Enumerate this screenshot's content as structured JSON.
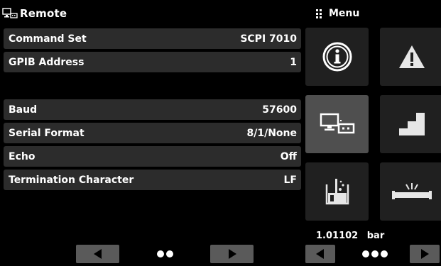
{
  "screen": {
    "title": "Remote",
    "title_icon": "remote-pc-device-icon"
  },
  "settings": [
    {
      "label": "Command Set",
      "value": "SCPI 7010"
    },
    {
      "label": "GPIB Address",
      "value": "1"
    },
    {
      "label": "Baud",
      "value": "57600"
    },
    {
      "label": "Serial Format",
      "value": "8/1/None"
    },
    {
      "label": "Echo",
      "value": "Off"
    },
    {
      "label": "Termination Character",
      "value": "LF"
    }
  ],
  "menu": {
    "title": "Menu",
    "tiles": [
      {
        "icon": "info-icon"
      },
      {
        "icon": "warning-icon"
      },
      {
        "icon": "remote-icon",
        "active": true
      },
      {
        "icon": "steps-icon"
      },
      {
        "icon": "leak-test-icon"
      },
      {
        "icon": "pipe-leak-icon"
      }
    ],
    "reading": {
      "value": "1.01102",
      "unit": "bar"
    }
  },
  "pager_left": {
    "prev_icon": "triangle-left-icon",
    "next_icon": "triangle-right-icon",
    "pages": 2
  },
  "pager_right": {
    "prev_icon": "triangle-left-icon",
    "next_icon": "triangle-right-icon",
    "pages": 3
  },
  "colors": {
    "background": "#000000",
    "row": "#2c2c2c",
    "tile": "#202020",
    "tile_active": "#4f4f4f",
    "button": "#5a5a5a"
  }
}
